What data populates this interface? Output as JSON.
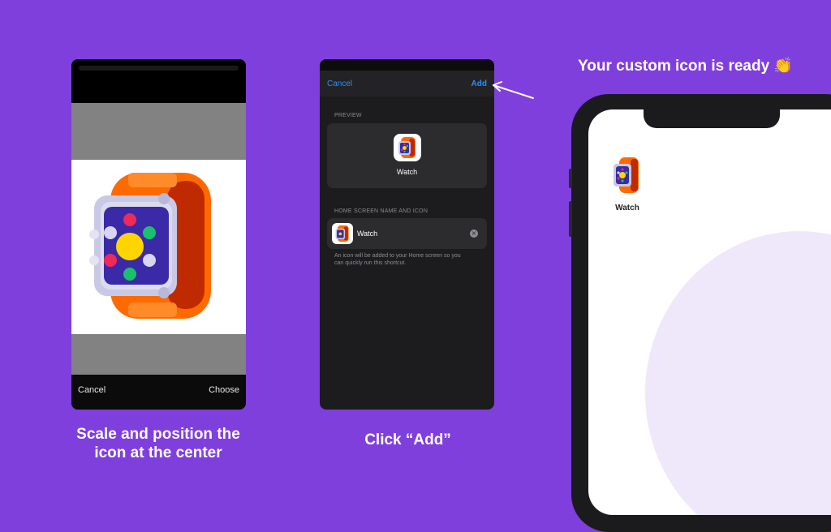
{
  "crop_screen": {
    "cancel_label": "Cancel",
    "choose_label": "Choose",
    "caption_line1": "Scale and position the",
    "caption_line2": "icon at the center"
  },
  "add_screen": {
    "cancel_label": "Cancel",
    "add_label": "Add",
    "preview_header": "PREVIEW",
    "preview_name": "Watch",
    "section_header": "HOME SCREEN NAME AND ICON",
    "name_value": "Watch",
    "note_line1": "An icon will be added to your Home screen so you",
    "note_line2": "can quickly run this shortcut.",
    "caption": "Click “Add”"
  },
  "home_screen": {
    "title": "Your custom icon is ready 👏",
    "app_label": "Watch"
  },
  "colors": {
    "background": "#7f3fdd",
    "ios_blue": "#2f8dfa",
    "dark_panel": "#2a2a2c"
  }
}
